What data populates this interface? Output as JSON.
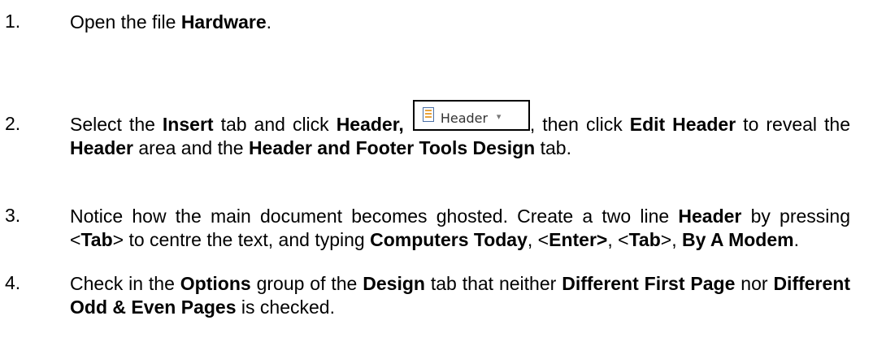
{
  "steps": [
    {
      "num": "1.",
      "parts": [
        {
          "t": "Open the file "
        },
        {
          "b": "Hardware"
        },
        {
          "t": "."
        }
      ]
    },
    {
      "num": "2.",
      "parts": [
        {
          "t": "Select the "
        },
        {
          "b": "Insert"
        },
        {
          "t": " tab and click "
        },
        {
          "b": "Header,"
        },
        {
          "t": " "
        },
        {
          "btn": "header"
        },
        {
          "t": ", then click "
        },
        {
          "b": "Edit Header"
        },
        {
          "t": " to reveal the "
        },
        {
          "b": "Header"
        },
        {
          "t": " area and the "
        },
        {
          "b": "Header and Footer Tools Design"
        },
        {
          "t": " tab."
        }
      ]
    },
    {
      "num": "3.",
      "parts": [
        {
          "t": "Notice how the main document becomes ghosted. Create a two line "
        },
        {
          "b": "Header"
        },
        {
          "t": " by pressing <"
        },
        {
          "b": "Tab"
        },
        {
          "t": "> to centre the text, and typing "
        },
        {
          "b": "Computers Today"
        },
        {
          "t": ", <"
        },
        {
          "b": "Enter>"
        },
        {
          "t": ", <"
        },
        {
          "b": "Tab"
        },
        {
          "t": ">, "
        },
        {
          "b": "By A Modem"
        },
        {
          "t": "."
        }
      ]
    },
    {
      "num": "4.",
      "parts": [
        {
          "t": "Check in the "
        },
        {
          "b": "Options"
        },
        {
          "t": " group of the "
        },
        {
          "b": "Design"
        },
        {
          "t": " tab that neither "
        },
        {
          "b": "Different First Page"
        },
        {
          "t": " nor "
        },
        {
          "b": "Different Odd & Even Pages"
        },
        {
          "t": " is checked."
        }
      ]
    }
  ],
  "header_button": {
    "label": "Header",
    "icon": "header-icon",
    "arrow": "▾"
  }
}
